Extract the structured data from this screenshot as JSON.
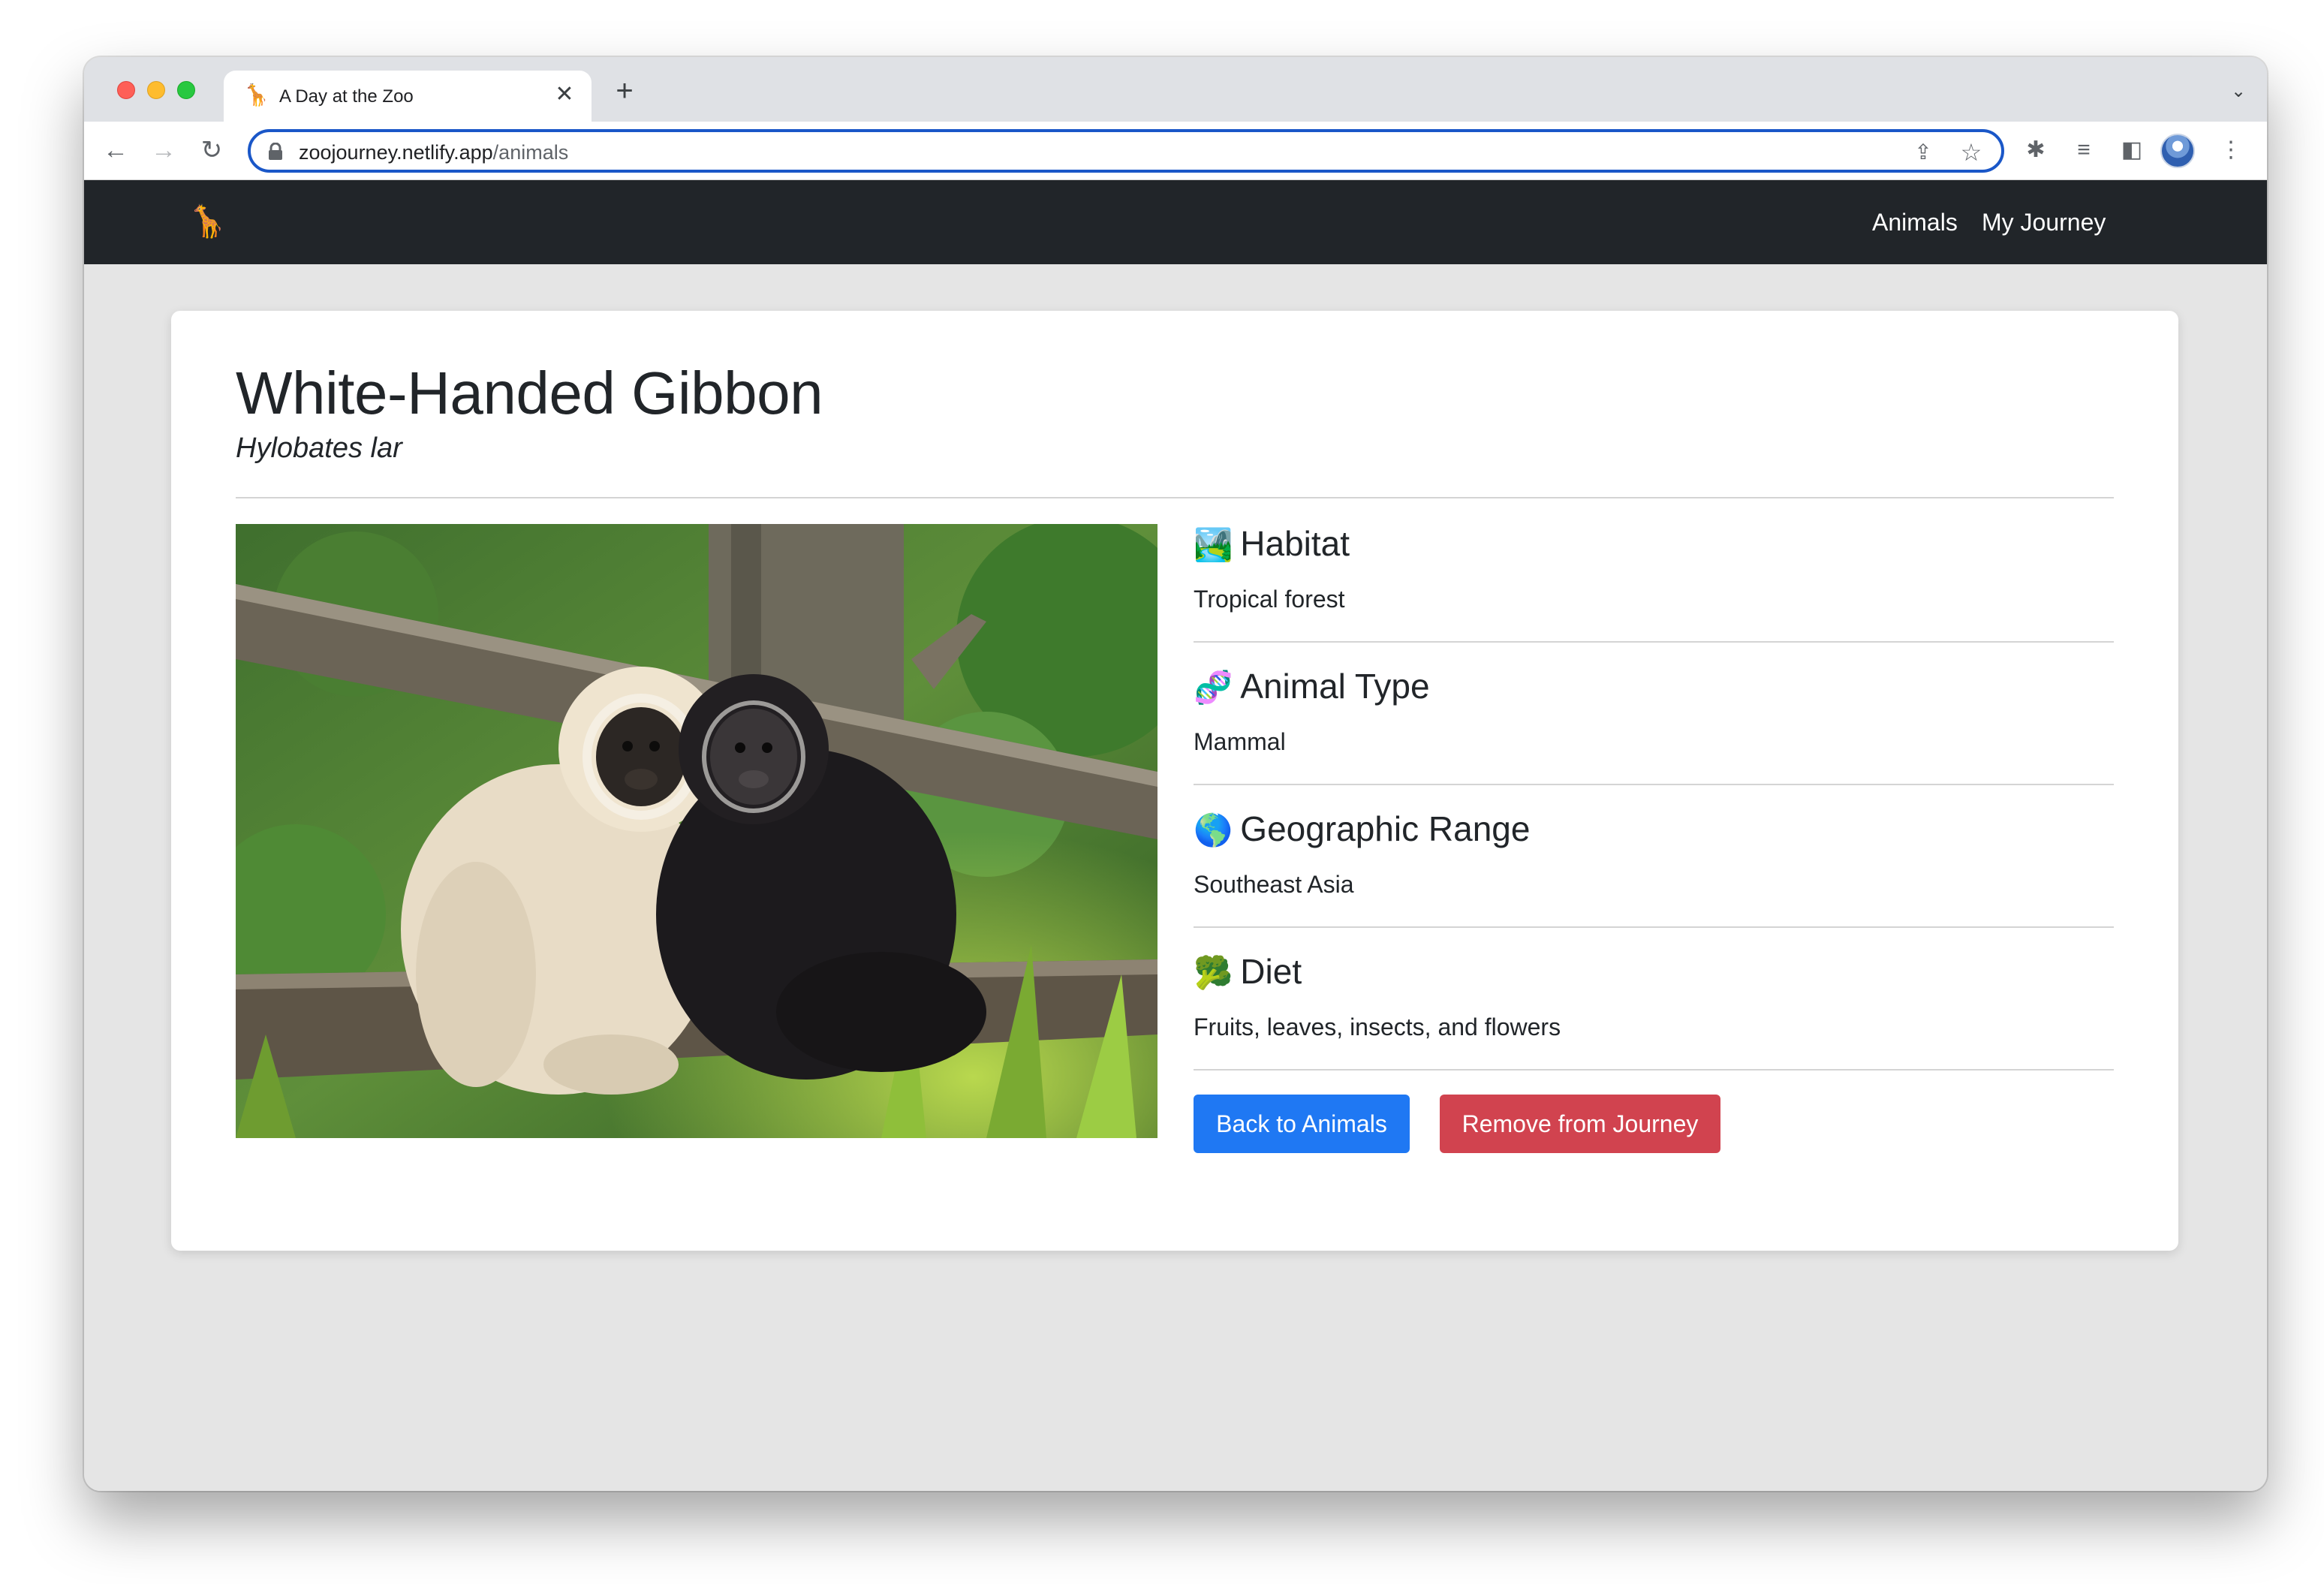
{
  "browser": {
    "tab": {
      "favicon": "🦒",
      "title": "A Day at the Zoo"
    },
    "url": {
      "host": "zoojourney.netlify.app",
      "path": "/animals"
    },
    "icons": {
      "back": "arrow-left-icon",
      "forward": "arrow-right-icon",
      "reload": "reload-icon",
      "lock": "lock-icon",
      "share": "share-icon",
      "star": "star-icon",
      "extensions": "puzzle-icon",
      "media": "media-queue-icon",
      "sidepanel": "side-panel-icon",
      "menu": "kebab-menu-icon"
    }
  },
  "site": {
    "brand": "🦒",
    "nav": {
      "animals": "Animals",
      "journey": "My Journey"
    }
  },
  "animal": {
    "name": "White-Handed Gibbon",
    "scientific_name": "Hylobates lar",
    "photo_icon": "gibbon-photo",
    "facts": [
      {
        "emoji": "🏞️",
        "label": "Habitat",
        "value": "Tropical forest"
      },
      {
        "emoji": "🧬",
        "label": "Animal Type",
        "value": "Mammal"
      },
      {
        "emoji": "🌎",
        "label": "Geographic Range",
        "value": "Southeast Asia"
      },
      {
        "emoji": "🥦",
        "label": "Diet",
        "value": "Fruits, leaves, insects, and flowers"
      }
    ]
  },
  "actions": {
    "back": "Back to Animals",
    "remove": "Remove from Journey"
  },
  "colors": {
    "navbar": "#212529",
    "primary": "#1f78f3",
    "danger": "#d1434f",
    "omnibox_focus": "#1a57c8"
  }
}
